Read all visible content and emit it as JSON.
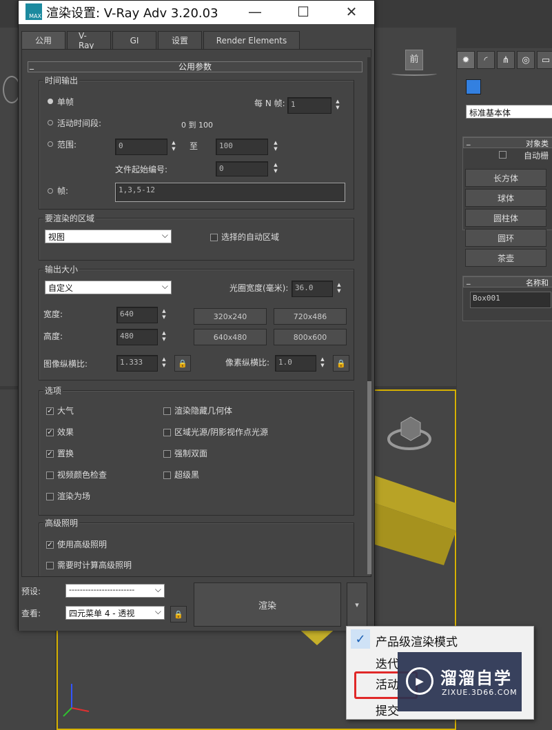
{
  "colors": {
    "accent": "#3380e0",
    "highlight": "#e02828",
    "viewport_border": "#d6b100",
    "box": "#c8b22a"
  },
  "dialog": {
    "title": "渲染设置: V-Ray Adv 3.20.03",
    "icon_label": "MAX",
    "controls": {
      "minimize": "—",
      "maximize": "☐",
      "close": "✕"
    },
    "tabs": [
      "公用",
      "V-Ray",
      "GI",
      "设置",
      "Render Elements"
    ],
    "section_header": "公用参数",
    "time_output": {
      "title": "时间输出",
      "single": "单帧",
      "every_n_label": "每 N 帧:",
      "every_n_value": "1",
      "active_segment": "活动时间段:",
      "active_range": "0 到 100",
      "range": "范围:",
      "range_from": "0",
      "range_to_label": "至",
      "range_to": "100",
      "file_start_label": "文件起始编号:",
      "file_start": "0",
      "frames": "帧:",
      "frames_value": "1,3,5-12"
    },
    "area": {
      "title": "要渲染的区域",
      "value": "视图",
      "auto_region": "选择的自动区域"
    },
    "output_size": {
      "title": "输出大小",
      "preset": "自定义",
      "aperture_label": "光圈宽度(毫米):",
      "aperture": "36.0",
      "width_label": "宽度:",
      "width": "640",
      "height_label": "高度:",
      "height": "480",
      "presets": [
        "320x240",
        "720x486",
        "640x480",
        "800x600"
      ],
      "image_aspect_label": "图像纵横比:",
      "image_aspect": "1.333",
      "pixel_aspect_label": "像素纵横比:",
      "pixel_aspect": "1.0"
    },
    "options": {
      "title": "选项",
      "items_left": [
        {
          "label": "大气",
          "checked": true
        },
        {
          "label": "效果",
          "checked": true
        },
        {
          "label": "置换",
          "checked": true
        },
        {
          "label": "视频颜色检查",
          "checked": false
        },
        {
          "label": "渲染为场",
          "checked": false
        }
      ],
      "items_right": [
        {
          "label": "渲染隐藏几何体",
          "checked": false
        },
        {
          "label": "区域光源/阴影视作点光源",
          "checked": false
        },
        {
          "label": "强制双面",
          "checked": false
        },
        {
          "label": "超级黑",
          "checked": false
        }
      ]
    },
    "advanced_lighting": {
      "title": "高级照明",
      "use": "使用高级照明",
      "compute": "需要时计算高级照明"
    },
    "footer": {
      "preset_label": "预设:",
      "preset_value": "------------------------",
      "view_label": "查看:",
      "view_value": "四元菜单 4 - 透视",
      "render_button": "渲染",
      "render_menu_arrow": "▾"
    }
  },
  "command_panel": {
    "dropdown": "标准基本体",
    "object_type_title": "对象类",
    "autogrid": "自动栅",
    "buttons": [
      "长方体",
      "球体",
      "圆柱体",
      "圆环",
      "茶壶"
    ],
    "name_color_title": "名称和",
    "name_value": "Box001"
  },
  "viewport": {
    "front_label": "前"
  },
  "context_menu": {
    "items": [
      "产品级渲染模式",
      "迭代",
      "活动",
      "提交"
    ]
  },
  "watermark": {
    "title": "溜溜自学",
    "subtitle": "ZIXUE.3D66.COM"
  }
}
